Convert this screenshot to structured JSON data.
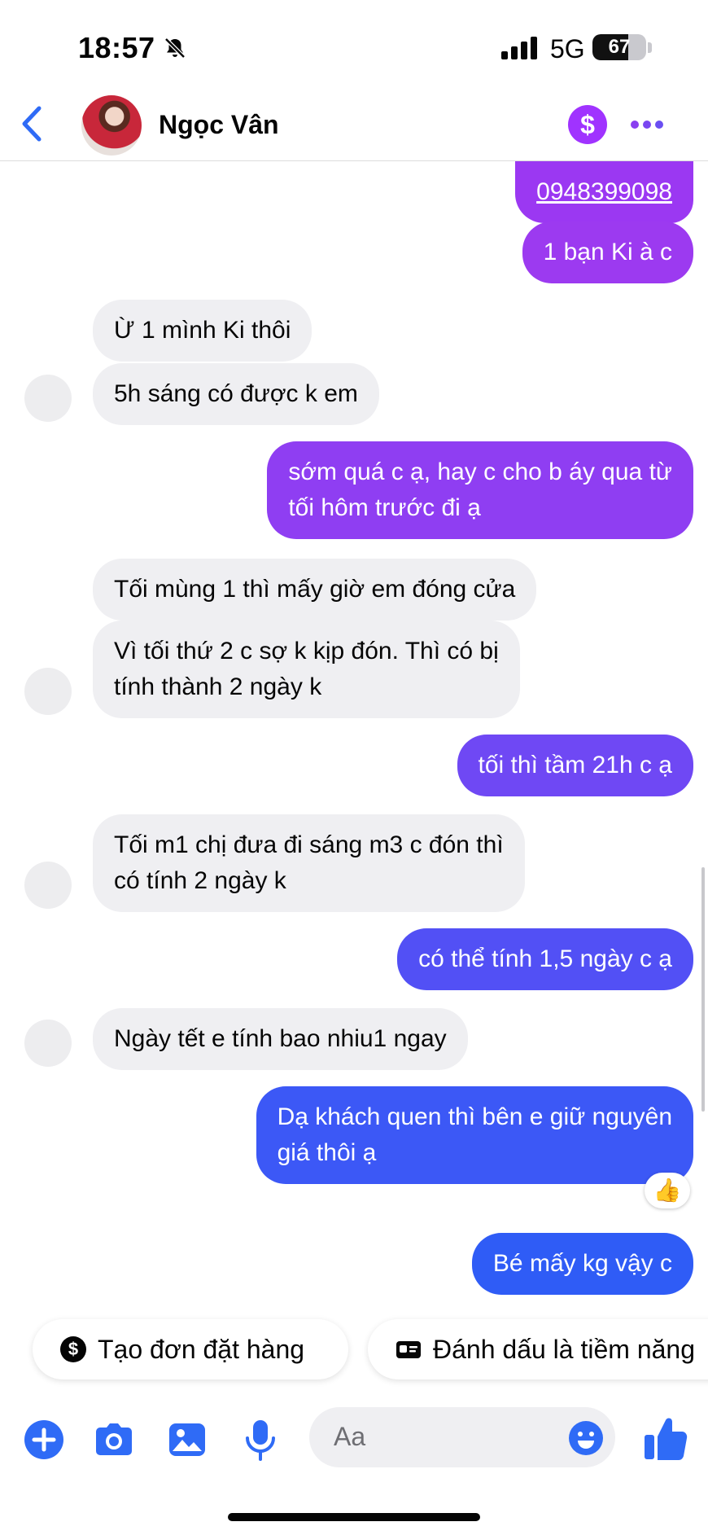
{
  "status_bar": {
    "time": "18:57",
    "network": "5G",
    "battery": "67",
    "battery_level": 0.67
  },
  "header": {
    "contact_name": "Ngọc Vân"
  },
  "colors": {
    "outgoing_top": "#9b38f2",
    "outgoing_bottom": "#2f5cf6",
    "incoming_bg": "#efeff2",
    "accent": "#2f6bf6"
  },
  "messages": [
    {
      "dir": "out",
      "lines": [
        "0948399098"
      ],
      "link": true
    },
    {
      "dir": "out",
      "lines": [
        "1 bạn Ki à c"
      ]
    },
    {
      "dir": "in",
      "lines": [
        "Ừ 1 mình Ki thôi"
      ]
    },
    {
      "dir": "in",
      "lines": [
        "5h sáng có được k em"
      ]
    },
    {
      "dir": "out",
      "lines": [
        "sớm quá c ạ, hay c cho b áy qua từ",
        "tối hôm trước đi ạ"
      ]
    },
    {
      "dir": "in",
      "lines": [
        "Tối mùng 1 thì mấy giờ em đóng cửa"
      ]
    },
    {
      "dir": "in",
      "lines": [
        "Vì tối thứ 2 c sợ k kịp đón. Thì có bị",
        "tính thành 2 ngày k"
      ]
    },
    {
      "dir": "out",
      "lines": [
        "tối thì tầm 21h c ạ"
      ]
    },
    {
      "dir": "in",
      "lines": [
        "Tối m1 chị đưa đi sáng m3 c đón thì",
        "có tính 2 ngày k"
      ]
    },
    {
      "dir": "out",
      "lines": [
        "có thể tính 1,5 ngày c ạ"
      ]
    },
    {
      "dir": "in",
      "lines": [
        "Ngày tết e tính bao nhiu1 ngay"
      ]
    },
    {
      "dir": "out",
      "lines": [
        "Dạ khách quen thì bên e giữ nguyên",
        "giá thôi ạ"
      ],
      "reaction": "👍"
    },
    {
      "dir": "out",
      "lines": [
        "Bé mấy kg vậy c"
      ]
    }
  ],
  "quick_replies": [
    {
      "label": "Tạo đơn đặt hàng",
      "icon": "dollar-circle-icon"
    },
    {
      "label": "Đánh dấu là tiềm năng",
      "icon": "id-card-icon"
    }
  ],
  "composer": {
    "placeholder": "Aa"
  }
}
